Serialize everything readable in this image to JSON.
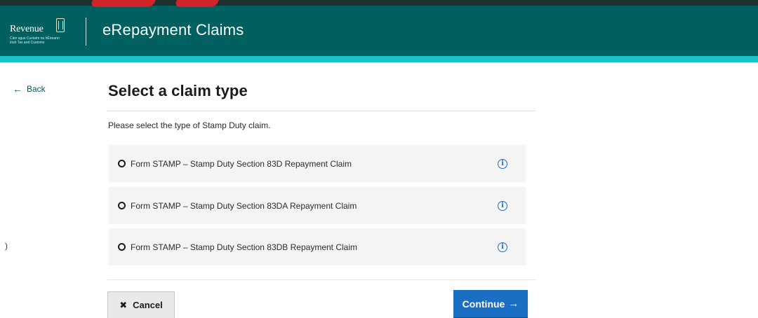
{
  "header": {
    "logo_word": "Revenue",
    "logo_subtext": [
      "Cáin agus Custaim na hÉireann",
      "Irish Tax and Customs"
    ],
    "app_title": "eRepayment Claims",
    "colors": {
      "bar": "#00605f",
      "accent": "#19c2c4"
    }
  },
  "nav": {
    "back_label": "Back",
    "back_icon": "arrow-left-icon"
  },
  "main": {
    "title": "Select a claim type",
    "instruction": "Please select the type of Stamp Duty claim.",
    "options": [
      {
        "label": "Form STAMP – Stamp Duty Section 83D Repayment Claim",
        "selected": false,
        "info_icon": "info-icon"
      },
      {
        "label": "Form STAMP – Stamp Duty Section 83DA Repayment Claim",
        "selected": false,
        "info_icon": "info-icon"
      },
      {
        "label": "Form STAMP – Stamp Duty Section 83DB Repayment Claim",
        "selected": false,
        "info_icon": "info-icon"
      }
    ],
    "info_glyph": "i"
  },
  "actions": {
    "cancel_label": "Cancel",
    "cancel_icon": "close-icon",
    "continue_label": "Continue",
    "continue_icon": "arrow-right-icon",
    "colors": {
      "primary": "#1a6fc4",
      "secondary": "#e9e9e9"
    }
  },
  "edge_mark": ")"
}
